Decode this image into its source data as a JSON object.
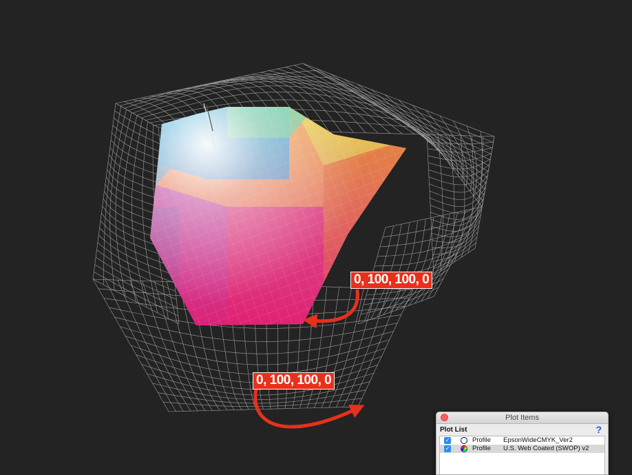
{
  "callouts": [
    {
      "label": "0, 100, 100, 0"
    },
    {
      "label": "0, 100, 100, 0"
    }
  ],
  "panel": {
    "title": "Plot Items",
    "section_label": "Plot List",
    "help_label": "?",
    "items": [
      {
        "type": "Profile",
        "name": "EpsonWideCMYK_Ver2",
        "checked": true,
        "icon": "outline-circle-icon"
      },
      {
        "type": "Profile",
        "name": "U.S. Web Coated (SWOP) v2",
        "checked": true,
        "icon": "color-wheel-icon",
        "selected": true
      }
    ]
  },
  "colors": {
    "background": "#232323",
    "wire": "#9a9a9a",
    "callout": "#e8301c",
    "arrow": "#e8301c"
  }
}
